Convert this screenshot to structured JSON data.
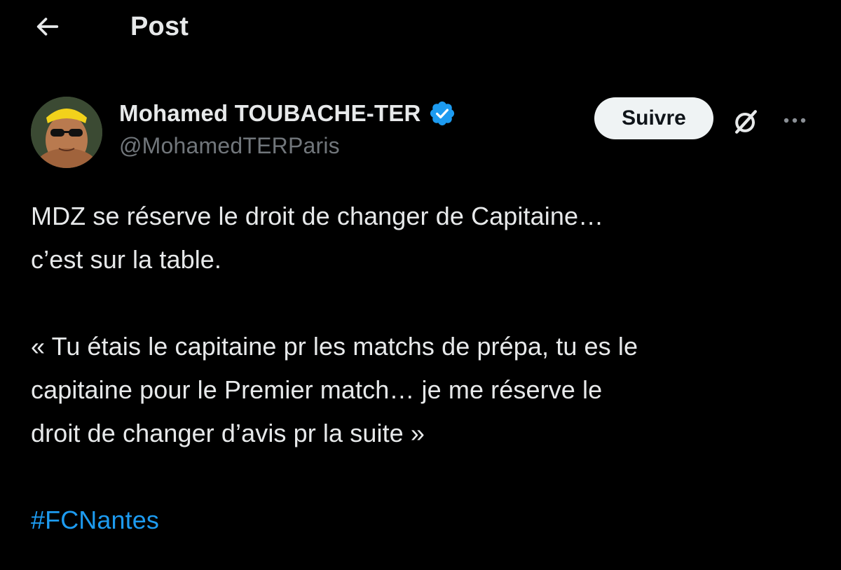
{
  "header": {
    "back_icon": "arrow-left-icon",
    "title": "Post"
  },
  "author": {
    "display_name": "Mohamed TOUBACHE-TER",
    "handle": "@MohamedTERParis",
    "verified": true,
    "verified_color": "#1d9bf0"
  },
  "actions": {
    "follow_label": "Suivre",
    "grok_icon": "grok-slash-icon",
    "more_icon": "more-dots-icon"
  },
  "post": {
    "line1": "MDZ se réserve le droit de changer de Capitaine…",
    "line2": "c’est sur la table.",
    "quote_line1": "« Tu étais le capitaine pr les matchs de prépa, tu es le",
    "quote_line2": "capitaine pour le Premier match… je me réserve le",
    "quote_line3": "droit de changer d’avis pr la suite »",
    "hashtag": "#FCNantes"
  },
  "colors": {
    "background": "#000000",
    "text": "#e7e9ea",
    "secondary_text": "#71767b",
    "link": "#1d9bf0",
    "button_bg": "#eff3f4"
  }
}
